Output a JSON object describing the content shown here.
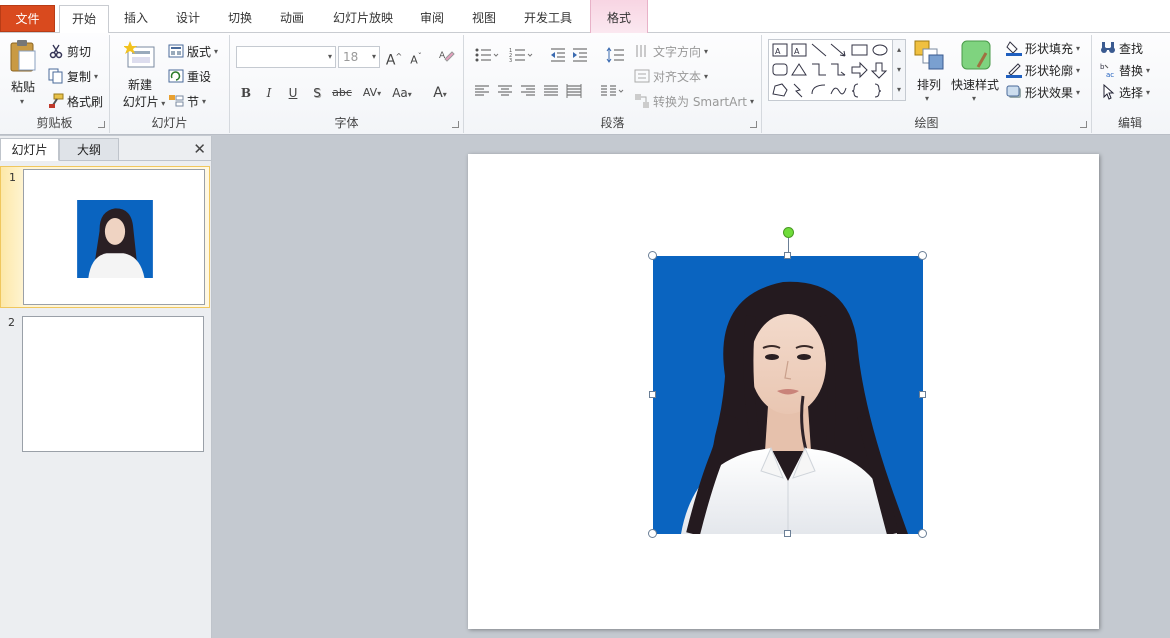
{
  "tabs": [
    {
      "label": "文件",
      "name": "tab-file"
    },
    {
      "label": "开始",
      "name": "tab-home"
    },
    {
      "label": "插入",
      "name": "tab-insert"
    },
    {
      "label": "设计",
      "name": "tab-design"
    },
    {
      "label": "切换",
      "name": "tab-transitions"
    },
    {
      "label": "动画",
      "name": "tab-animations"
    },
    {
      "label": "幻灯片放映",
      "name": "tab-slideshow"
    },
    {
      "label": "审阅",
      "name": "tab-review"
    },
    {
      "label": "视图",
      "name": "tab-view"
    },
    {
      "label": "开发工具",
      "name": "tab-developer"
    },
    {
      "label": "格式",
      "name": "tab-format"
    }
  ],
  "clipboard": {
    "paste": "粘贴",
    "cut": "剪切",
    "copy": "复制",
    "format_painter": "格式刷",
    "group_label": "剪贴板"
  },
  "slides_group": {
    "new_slide_line1": "新建",
    "new_slide_line2": "幻灯片",
    "layout": "版式",
    "reset": "重设",
    "section": "节",
    "group_label": "幻灯片"
  },
  "font": {
    "font_name": "",
    "font_size": "18",
    "bold": "B",
    "italic": "I",
    "underline": "U",
    "shadow": "S",
    "strike": "abc",
    "spacing": "AV",
    "case": "Aa",
    "color": "A",
    "grow": "A",
    "shrink": "A",
    "group_label": "字体"
  },
  "paragraph": {
    "text_direction": "文字方向",
    "align_text": "对齐文本",
    "convert_smartart": "转换为 SmartArt",
    "group_label": "段落"
  },
  "drawing": {
    "arrange": "排列",
    "quick_styles": "快速样式",
    "shape_fill": "形状填充",
    "shape_outline": "形状轮廓",
    "shape_effects": "形状效果",
    "group_label": "绘图"
  },
  "editing": {
    "find": "查找",
    "replace": "替换",
    "select": "选择",
    "group_label": "编辑"
  },
  "left_pane": {
    "tab_slides": "幻灯片",
    "tab_outline": "大纲",
    "close": "✕",
    "slides": [
      {
        "number": "1"
      },
      {
        "number": "2"
      }
    ]
  },
  "colors": {
    "photo_bg": "#0a64c0",
    "file_tab": "#d94a1e",
    "selected_thumb": "#f0c75e",
    "rotate_handle": "#6fdc3a"
  },
  "icons": [
    "paste-icon",
    "cut-icon",
    "copy-icon",
    "format-painter-icon",
    "new-slide-icon",
    "layout-icon",
    "reset-icon",
    "section-icon",
    "arrange-icon",
    "quick-styles-icon",
    "fill-icon",
    "outline-icon",
    "effects-icon",
    "find-icon",
    "replace-icon",
    "select-icon",
    "close-icon"
  ]
}
